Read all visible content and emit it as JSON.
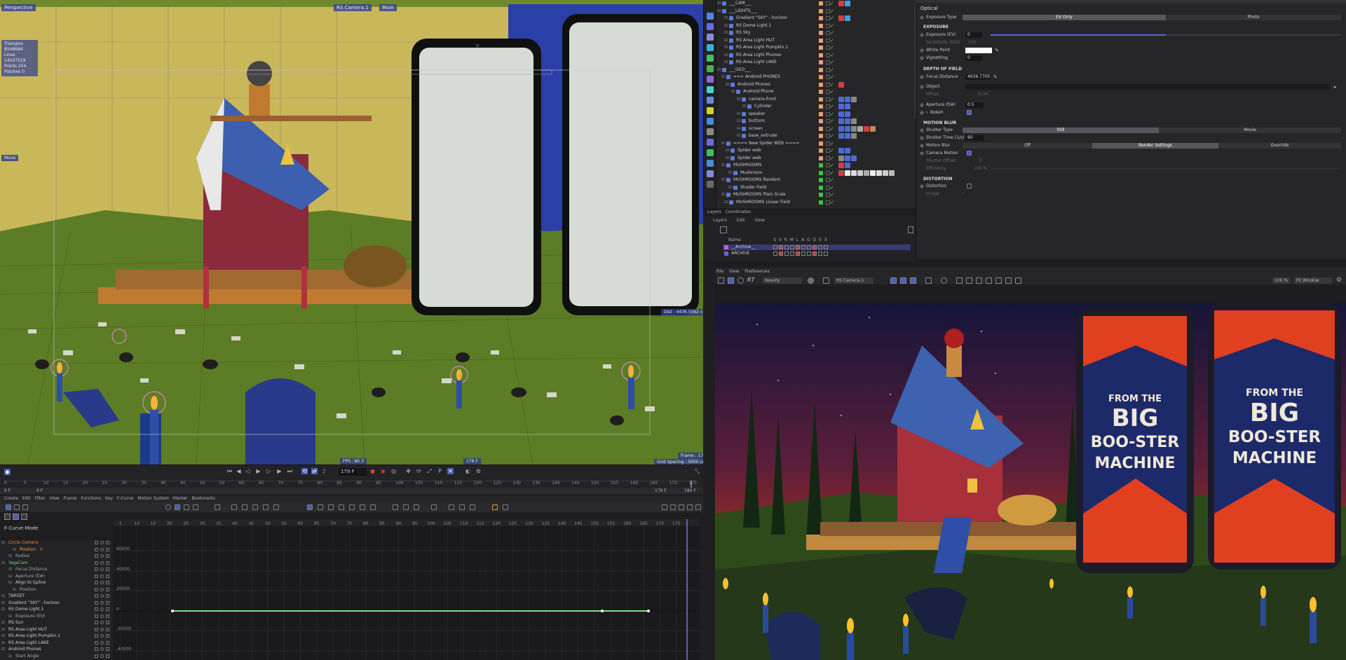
{
  "viewport": {
    "view_name": "Perspective",
    "camera": "RS Camera.1",
    "display": "Main",
    "stats": {
      "triangles": "Triangles 8548684",
      "lines": "Lines    14107519",
      "points": "Points   254",
      "patches": "Patches  0"
    },
    "move_label": "Move",
    "dist": "Dist : 4436.5062 cm",
    "fps": "FPS : 85.3",
    "frame": "Frame : 179",
    "frame_badge": "179 F",
    "grid_spacing": "Grid Spacing : 5000 cm"
  },
  "timeline": {
    "current_frame": "179 F",
    "range_start": "0 F",
    "range_start2": "0 F",
    "range_end": "179 F",
    "range_end2": "180 F",
    "ticks": [
      "0",
      "5",
      "10",
      "15",
      "20",
      "25",
      "30",
      "35",
      "40",
      "45",
      "50",
      "55",
      "60",
      "65",
      "70",
      "75",
      "80",
      "85",
      "90",
      "95",
      "100",
      "105",
      "110",
      "115",
      "120",
      "125",
      "130",
      "135",
      "140",
      "145",
      "150",
      "155",
      "160",
      "165",
      "170",
      "175"
    ]
  },
  "fcurve": {
    "menu": [
      "Create",
      "Edit",
      "Filter",
      "View",
      "Frame",
      "Functions",
      "Key",
      "F-Curve",
      "Motion System",
      "Marker",
      "Bookmarks"
    ],
    "mode": "F-Curve Mode",
    "ruler": [
      "5",
      "10",
      "15",
      "20",
      "25",
      "30",
      "35",
      "40",
      "45",
      "50",
      "55",
      "60",
      "65",
      "70",
      "75",
      "80",
      "85",
      "90",
      "95",
      "100",
      "105",
      "110",
      "115",
      "120",
      "125",
      "130",
      "135",
      "140",
      "145",
      "150",
      "155",
      "160",
      "165",
      "170",
      "175"
    ],
    "y_labels": [
      "60000",
      "40000",
      "20000",
      "0",
      "-20000",
      "-40000"
    ],
    "tree": [
      {
        "label": "Circle Camera",
        "color": "#e0883a",
        "indent": 12
      },
      {
        "label": "Position . Y",
        "color": "#f0a040",
        "indent": 28
      },
      {
        "label": "Radius",
        "color": "#a8a8ae",
        "indent": 22
      },
      {
        "label": "YagaCam",
        "color": "#7fd07f",
        "indent": 12
      },
      {
        "label": "Focus Distance",
        "color": "#a8a8ae",
        "indent": 22
      },
      {
        "label": "Aperture (f/#)",
        "color": "#a8a8ae",
        "indent": 22
      },
      {
        "label": "Align to Spline",
        "color": "#d0d0d4",
        "indent": 22
      },
      {
        "label": "Position",
        "color": "#a8a8ae",
        "indent": 28
      },
      {
        "label": "TARGET",
        "color": "#d0d0d4",
        "indent": 12
      },
      {
        "label": "Gradient \"SKY\" - horizon",
        "color": "#d0d0d4",
        "indent": 12
      },
      {
        "label": "RS Dome Light.1",
        "color": "#d0d0d4",
        "indent": 12
      },
      {
        "label": "Exposure (EV)",
        "color": "#a8a8ae",
        "indent": 22
      },
      {
        "label": "RS Sun",
        "color": "#d0d0d4",
        "indent": 12
      },
      {
        "label": "RS Area Light HUT",
        "color": "#d0d0d4",
        "indent": 12
      },
      {
        "label": "RS Area Light Pumpkin.1",
        "color": "#d0d0d4",
        "indent": 12
      },
      {
        "label": "RS Area Light LAKE",
        "color": "#d0d0d4",
        "indent": 12
      },
      {
        "label": "Android Phones",
        "color": "#d0d0d4",
        "indent": 12
      },
      {
        "label": "Start Angle",
        "color": "#a8a8ae",
        "indent": 22
      }
    ]
  },
  "object_manager": {
    "rows": [
      {
        "label": "___CAM___",
        "indent": 8,
        "color": "#cfcfd3",
        "sq": "#e8a070"
      },
      {
        "label": "___LIGHTS___",
        "indent": 8,
        "color": "#cfcfd3",
        "sq": "#e8a070"
      },
      {
        "label": "Gradient \"SKY\" - horizon",
        "indent": 18,
        "color": "#cfcfd3",
        "sq": "#e8a070"
      },
      {
        "label": "RS Dome Light.1",
        "indent": 18,
        "color": "#cfcfd3",
        "sq": "#e8a070"
      },
      {
        "label": "RS Sky",
        "indent": 18,
        "color": "#cfcfd3",
        "sq": "#e8a070"
      },
      {
        "label": "RS Area Light HUT",
        "indent": 18,
        "color": "#cfcfd3",
        "sq": "#e8a070"
      },
      {
        "label": "RS Area Light Pumpkin.1",
        "indent": 18,
        "color": "#cfcfd3",
        "sq": "#e8a070"
      },
      {
        "label": "RS Area Light Phones",
        "indent": 18,
        "color": "#cfcfd3",
        "sq": "#e8a070"
      },
      {
        "label": "RS Area Light LAKE",
        "indent": 18,
        "color": "#cfcfd3",
        "sq": "#e8a070"
      },
      {
        "label": "___GEO___",
        "indent": 8,
        "color": "#cfcfd3",
        "sq": "#e8a070"
      },
      {
        "label": "==> Android PHONES",
        "indent": 14,
        "color": "#cfcfd3",
        "sq": "#e8a070"
      },
      {
        "label": "Android Phones",
        "indent": 20,
        "color": "#cfcfd3",
        "sq": "#e8a070"
      },
      {
        "label": "Android Phone",
        "indent": 28,
        "color": "#cfcfd3",
        "sq": "#e8a070"
      },
      {
        "label": "camera-front",
        "indent": 36,
        "color": "#cfcfd3",
        "sq": "#e8a070"
      },
      {
        "label": "Cylinder",
        "indent": 44,
        "color": "#cfcfd3",
        "sq": "#e8a070"
      },
      {
        "label": "speaker",
        "indent": 36,
        "color": "#cfcfd3",
        "sq": "#e8a070"
      },
      {
        "label": "buttons",
        "indent": 36,
        "color": "#cfcfd3",
        "sq": "#e8a070"
      },
      {
        "label": "screen",
        "indent": 36,
        "color": "#cfcfd3",
        "sq": "#e8a070"
      },
      {
        "label": "base_extrude",
        "indent": 36,
        "color": "#cfcfd3",
        "sq": "#e8a070"
      },
      {
        "label": "==== New Spider WEB ====",
        "indent": 14,
        "color": "#cfcfd3",
        "sq": "#e8a070"
      },
      {
        "label": "Spider web",
        "indent": 20,
        "color": "#cfcfd3",
        "sq": "#e8a070"
      },
      {
        "label": "Spider web",
        "indent": 20,
        "color": "#cfcfd3",
        "sq": "#e8a070"
      },
      {
        "label": "MUSHROOMS",
        "indent": 14,
        "color": "#cfcfd3",
        "sq": "#40c040"
      },
      {
        "label": "Mushroom",
        "indent": 24,
        "color": "#cfcfd3",
        "sq": "#40c040"
      },
      {
        "label": "MUSHROOMS Random",
        "indent": 14,
        "color": "#cfcfd3",
        "sq": "#40c040"
      },
      {
        "label": "Shader Field",
        "indent": 24,
        "color": "#cfcfd3",
        "sq": "#40c040"
      },
      {
        "label": "MUSHROOMS Plain Scale",
        "indent": 14,
        "color": "#cfcfd3",
        "sq": "#40c040"
      },
      {
        "label": "MUSHROOMS Linear Field",
        "indent": 18,
        "color": "#cfcfd3",
        "sq": "#40c040"
      }
    ]
  },
  "layers": {
    "tabs": [
      "Layers",
      "Coordinates"
    ],
    "menu": [
      "Layers",
      "Edit",
      "View"
    ],
    "head_name": "Name",
    "head_flags": "S V R M L A G D E X",
    "rows": [
      {
        "label": "__Archive__",
        "color": "#c060e0"
      },
      {
        "label": "ARCHIVE",
        "color": "#7060e0"
      }
    ]
  },
  "attributes": {
    "title": "Optical",
    "exposure_type_label": "Exposure Type",
    "exposure_type_options": [
      "EV Only",
      "Photo"
    ],
    "sec_exposure": "EXPOSURE",
    "exposure_label": "Exposure (EV)",
    "exposure_value": "0",
    "exposure_frac": 0.5,
    "sensitivity_label": "Sensitivity (ISO)",
    "sensitivity_value": "100",
    "white_point_label": "White Point",
    "vignetting_label": "Vignetting",
    "vignetting_value": "0",
    "sec_dof": "DEPTH OF FIELD",
    "focus_label": "Focus Distance",
    "focus_value": "4636.7705",
    "object_label": "Object",
    "offset_label": "Offset",
    "offset_value": "0 cm",
    "aperture_label": "Aperture (f/#)",
    "aperture_value": "0.5",
    "bokeh_label": "Bokeh",
    "sec_motion": "MOTION BLUR",
    "shutter_type_label": "Shutter Type",
    "shutter_type_options": [
      "Still",
      "Movie"
    ],
    "shutter_time_label": "Shutter Time (1/s)",
    "shutter_time_value": "60",
    "motion_blur_label": "Motion Blur",
    "motion_blur_options": [
      "Off",
      "Render Settings",
      "Override"
    ],
    "camera_motion_label": "Camera Motion",
    "shutter_offset_label": "Shutter Offset",
    "shutter_offset_value": "0",
    "efficiency_label": "Efficiency",
    "efficiency_value": "100 %",
    "sec_distortion": "DISTORTION",
    "distortion_label": "Distortion",
    "image_label": "Image"
  },
  "render_view": {
    "menu": [
      "File",
      "View",
      "Preferences"
    ],
    "rt_label": "RT",
    "aov": "Beauty",
    "camera": "RS Camera.1",
    "zoom": "100 %",
    "fit": "Fit Window",
    "phone_text": [
      "FROM THE",
      "BIG",
      "BOO-STER",
      "MACHINE"
    ]
  },
  "colors": {
    "accent": "#4c5fb0",
    "curve": "#7fe07f"
  }
}
